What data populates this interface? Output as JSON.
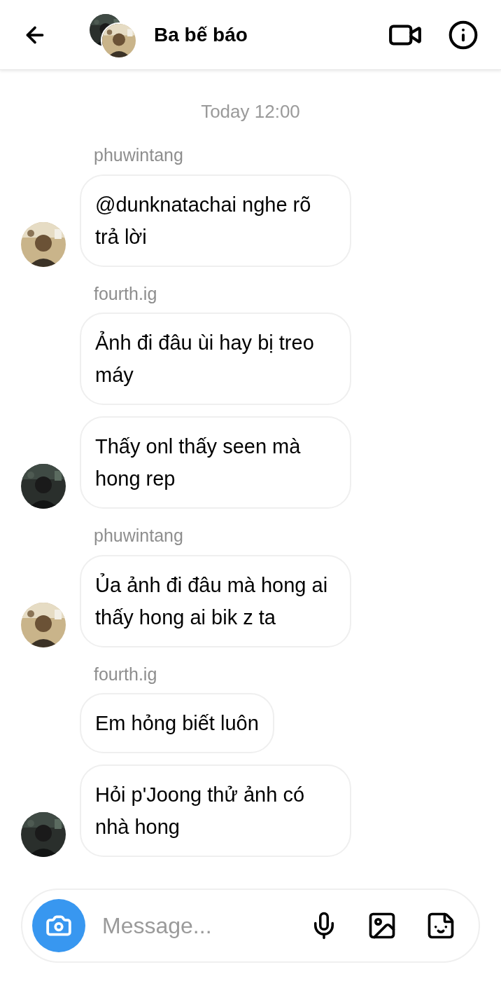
{
  "header": {
    "title": "Ba bế báo"
  },
  "timestamp": "Today 12:00",
  "groups": [
    {
      "sender": "phuwintang",
      "avatar": {
        "kind": "picture"
      },
      "messages": [
        "@dunknatachai nghe rõ trả lời"
      ]
    },
    {
      "sender": "fourth.ig",
      "avatar": {
        "kind": "picture"
      },
      "messages": [
        "Ảnh đi đâu ùi hay bị treo máy",
        "Thấy onl thấy seen mà hong rep"
      ]
    },
    {
      "sender": "phuwintang",
      "avatar": {
        "kind": "picture"
      },
      "messages": [
        "Ủa ảnh đi đâu mà hong ai thấy hong ai bik z ta"
      ]
    },
    {
      "sender": "fourth.ig",
      "avatar": {
        "kind": "picture"
      },
      "messages": [
        "Em hỏng biết luôn",
        "Hỏi p'Joong thử ảnh có nhà hong"
      ]
    }
  ],
  "composer": {
    "placeholder": "Message..."
  }
}
